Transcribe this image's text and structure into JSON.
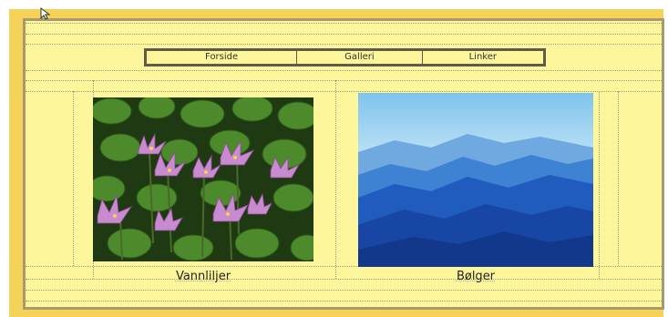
{
  "nav": {
    "items": [
      {
        "label": "Forside"
      },
      {
        "label": "Galleri"
      },
      {
        "label": "Linker"
      }
    ]
  },
  "gallery": {
    "items": [
      {
        "caption": "Vannliljer",
        "image": "water-lilies-photo"
      },
      {
        "caption": "Bølger",
        "image": "blue-mountains-photo"
      }
    ]
  },
  "colors": {
    "canvas": "#fdf69a",
    "page_background": "#f5d25a",
    "border": "#a89a6a"
  },
  "icons": [
    "mouse-pointer-icon"
  ]
}
